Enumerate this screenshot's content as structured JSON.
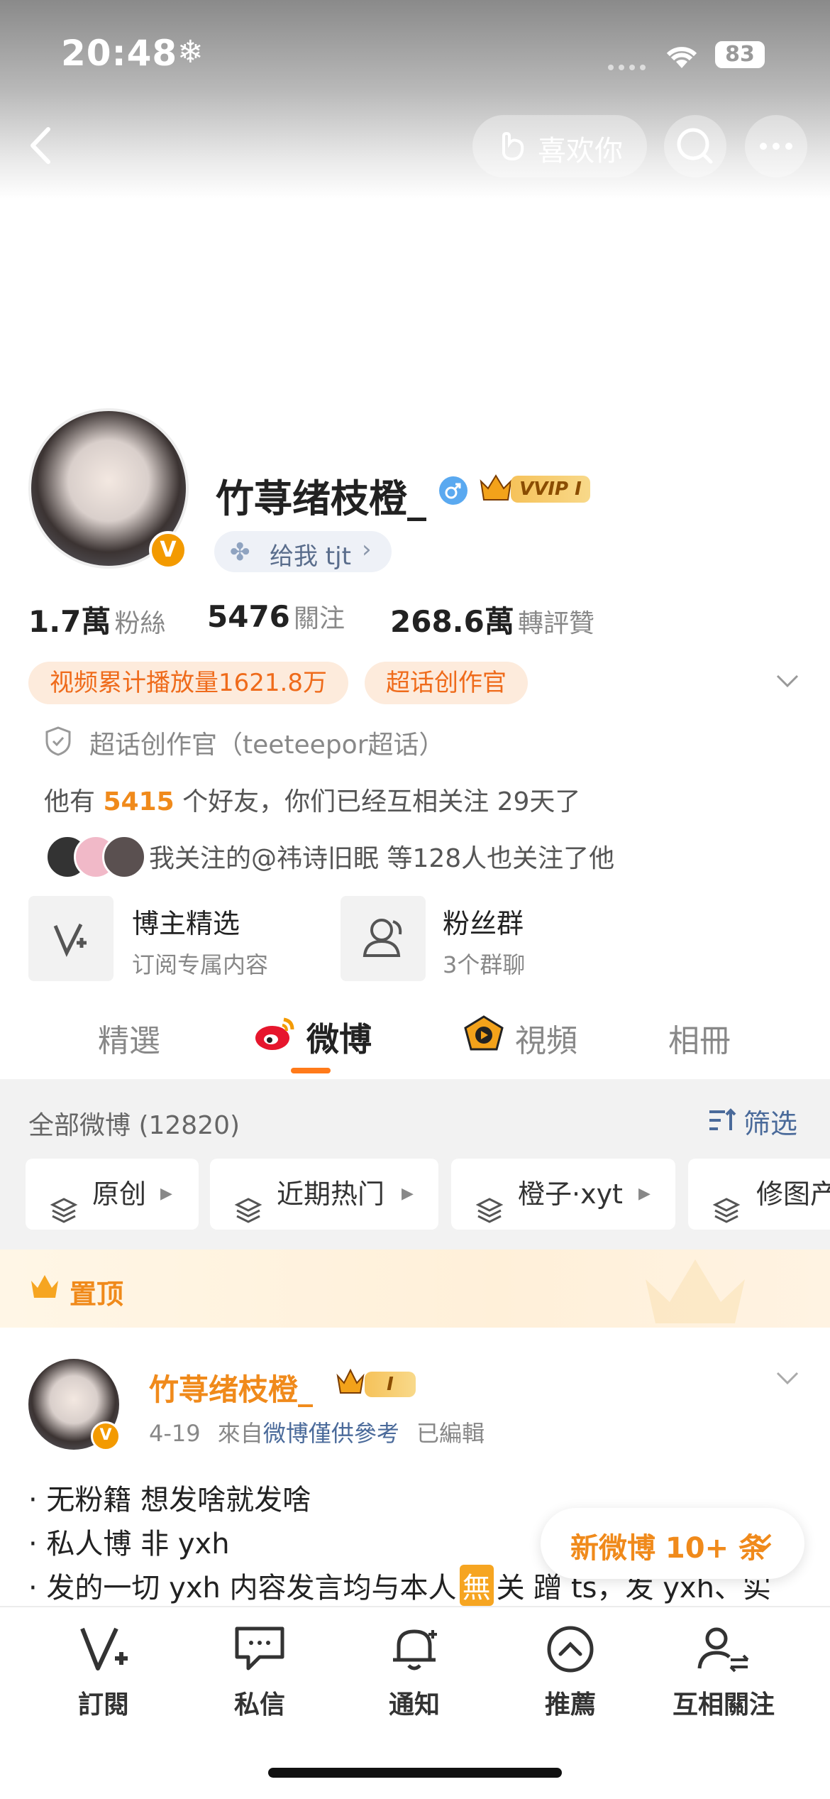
{
  "status": {
    "time": "20:48",
    "battery": "83"
  },
  "header": {
    "like_button": "喜欢你"
  },
  "profile": {
    "name": "竹荨绪枝橙_",
    "vip": "VVIP I",
    "pill": "给我 tjt",
    "stats": [
      {
        "num": "1.7萬",
        "label": "粉絲"
      },
      {
        "num": "5476",
        "label": "關注"
      },
      {
        "num": "268.6萬",
        "label": "轉評贊"
      }
    ],
    "tags": [
      "视频累计播放量1621.8万",
      "超话创作官"
    ],
    "honor": "超话创作官（teeteepor超话）",
    "friends": {
      "pre": "他有",
      "count": "5415",
      "mid": "个好友，你们已经互相关注",
      "days": "29",
      "post": "天了"
    },
    "mutual": "我关注的@祎诗旧眠 等128人也关注了他"
  },
  "features": [
    {
      "title": "博主精选",
      "sub": "订阅专属内容"
    },
    {
      "title": "粉丝群",
      "sub": "3个群聊"
    }
  ],
  "tabs": [
    "精選",
    "微博",
    "視頻",
    "相冊"
  ],
  "feed": {
    "all_label": "全部微博 (12820)",
    "filter": "筛选",
    "chips": [
      "原创",
      "近期热门",
      "橙子·xyt",
      "修图产"
    ]
  },
  "pinned": {
    "label": "置顶"
  },
  "post": {
    "name": "竹荨绪枝橙_",
    "vip": "I",
    "date": "4-19",
    "from_pre": "來自",
    "source": "微博僅供參考",
    "edited": "已編輯",
    "lines": [
      "· 无粉籍  想发啥就发啥",
      "· 私人博 非 yxh",
      "· 发的一切 yxh 内容发言均与本人",
      "关  蹭 ts，发 yxh、实"
    ],
    "no_char": "無"
  },
  "new_posts": "新微博 10+ 条",
  "nav": [
    "訂閱",
    "私信",
    "通知",
    "推薦",
    "互相關注"
  ]
}
